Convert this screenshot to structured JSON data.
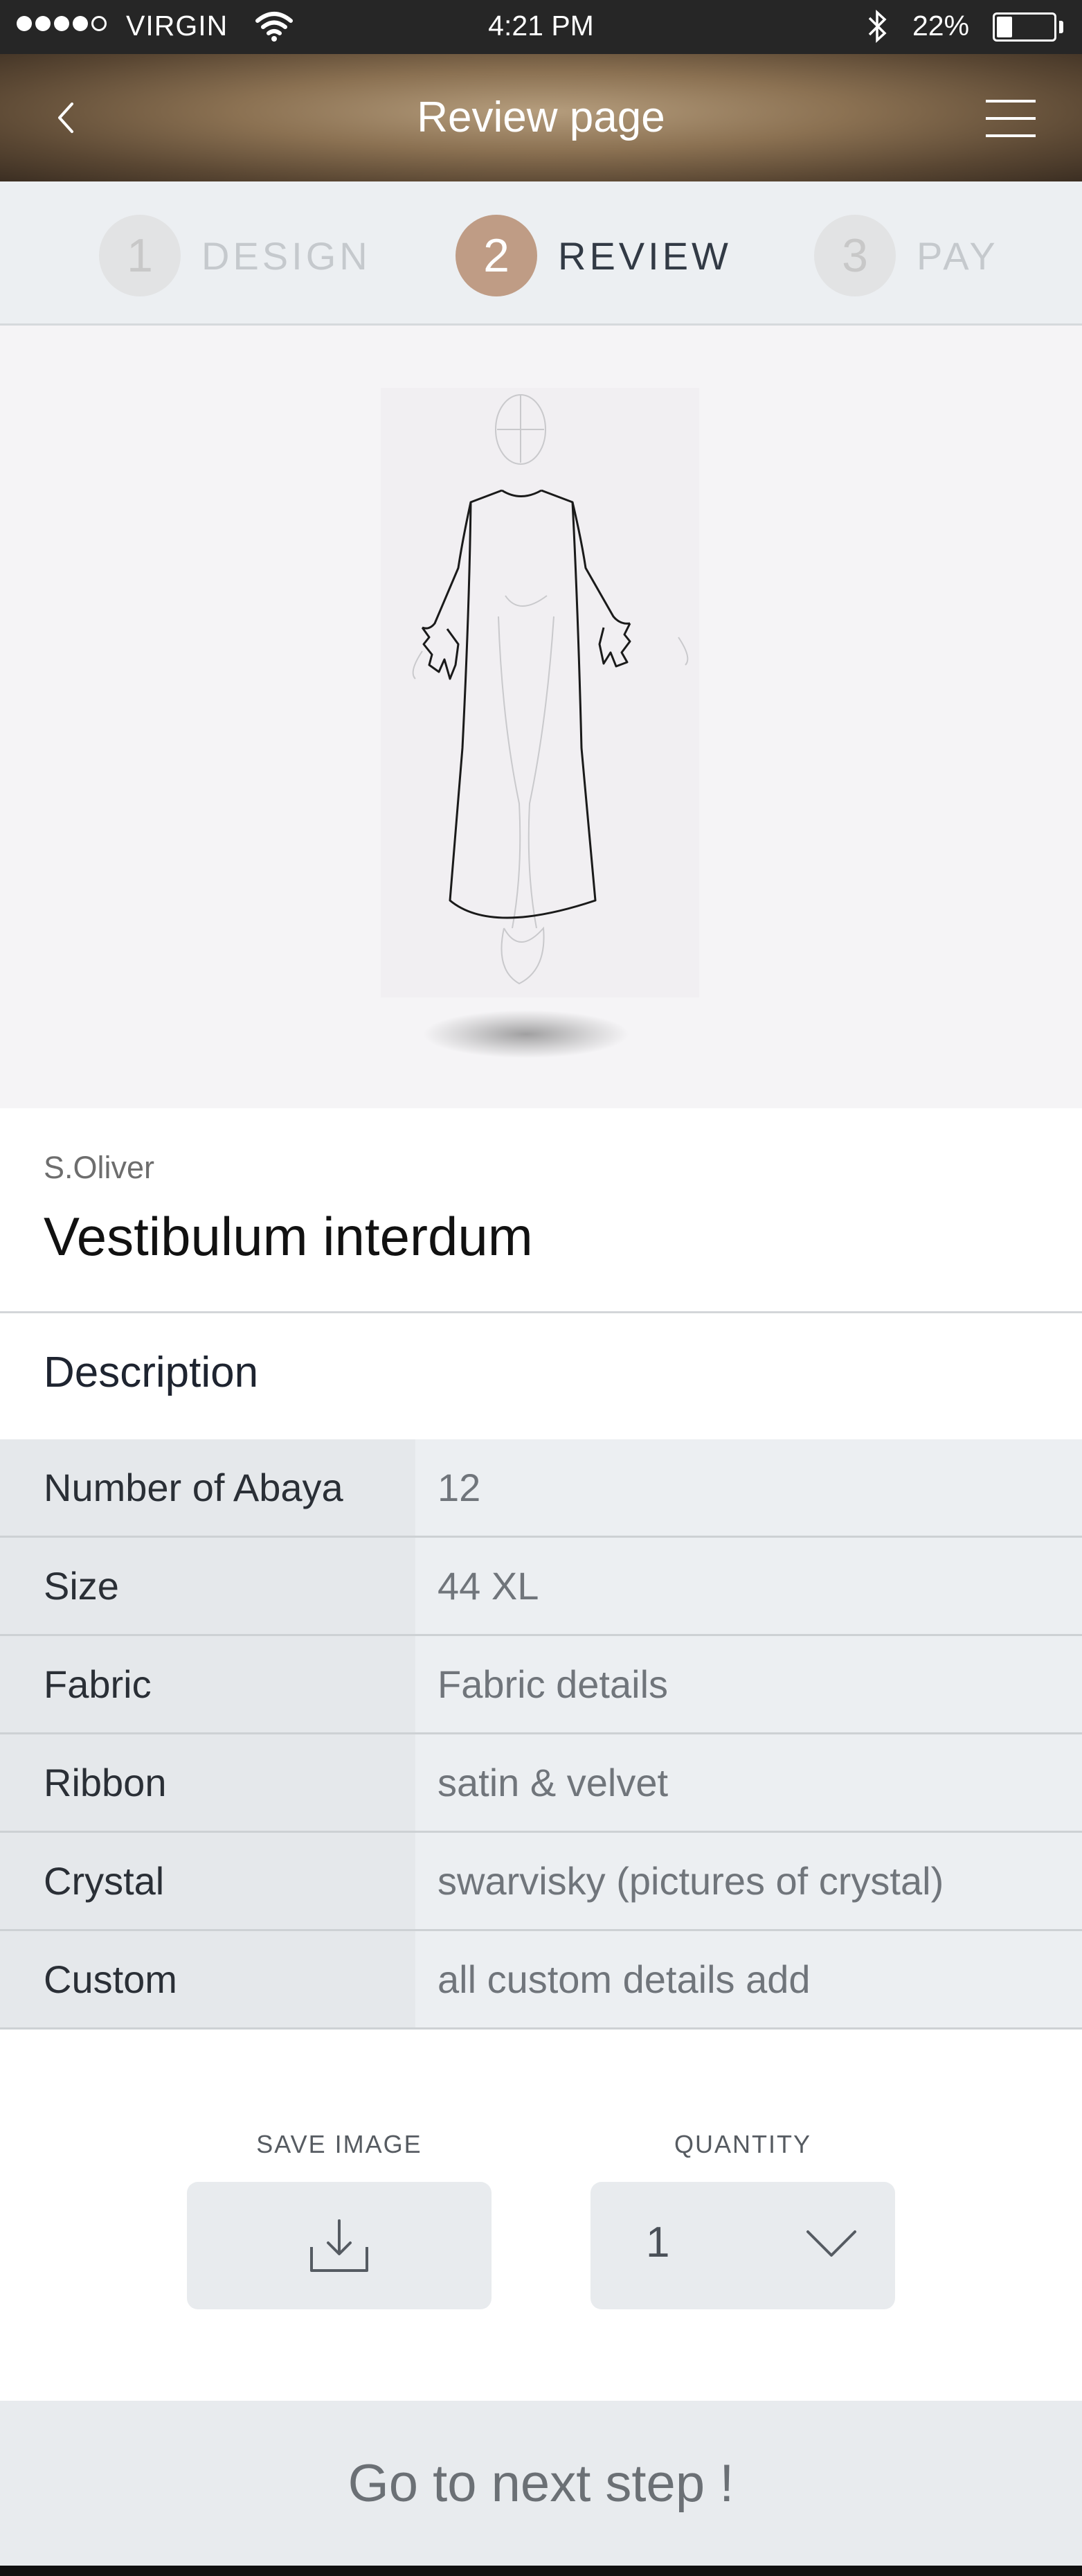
{
  "status_bar": {
    "carrier": "VIRGIN",
    "time": "4:21 PM",
    "battery": "22%"
  },
  "nav": {
    "title": "Review page",
    "back_icon": "chevron-left-icon",
    "menu_icon": "hamburger-menu-icon"
  },
  "steps": [
    {
      "number": "1",
      "label": "DESIGN",
      "active": false
    },
    {
      "number": "2",
      "label": "REVIEW",
      "active": true
    },
    {
      "number": "3",
      "label": "PAY",
      "active": false
    }
  ],
  "product": {
    "brand": "S.Oliver",
    "name": "Vestibulum interdum"
  },
  "description": {
    "title": "Description",
    "rows": [
      {
        "key": "Number of Abaya",
        "value": "12"
      },
      {
        "key": "Size",
        "value": "44 XL"
      },
      {
        "key": "Fabric",
        "value": "Fabric details"
      },
      {
        "key": "Ribbon",
        "value": "satin & velvet"
      },
      {
        "key": "Crystal",
        "value": "swarvisky (pictures of crystal)"
      },
      {
        "key": "Custom",
        "value": "all custom details add"
      }
    ]
  },
  "controls": {
    "save_label": "SAVE IMAGE",
    "save_icon": "download-icon",
    "quantity_label": "QUANTITY",
    "quantity_value": "1",
    "quantity_icon": "chevron-down-icon"
  },
  "cta": {
    "label": "Go to next step !"
  },
  "colors": {
    "accent": "#bf9c85",
    "step_bg": "#eceff2",
    "header_brown": "#8b7152"
  }
}
